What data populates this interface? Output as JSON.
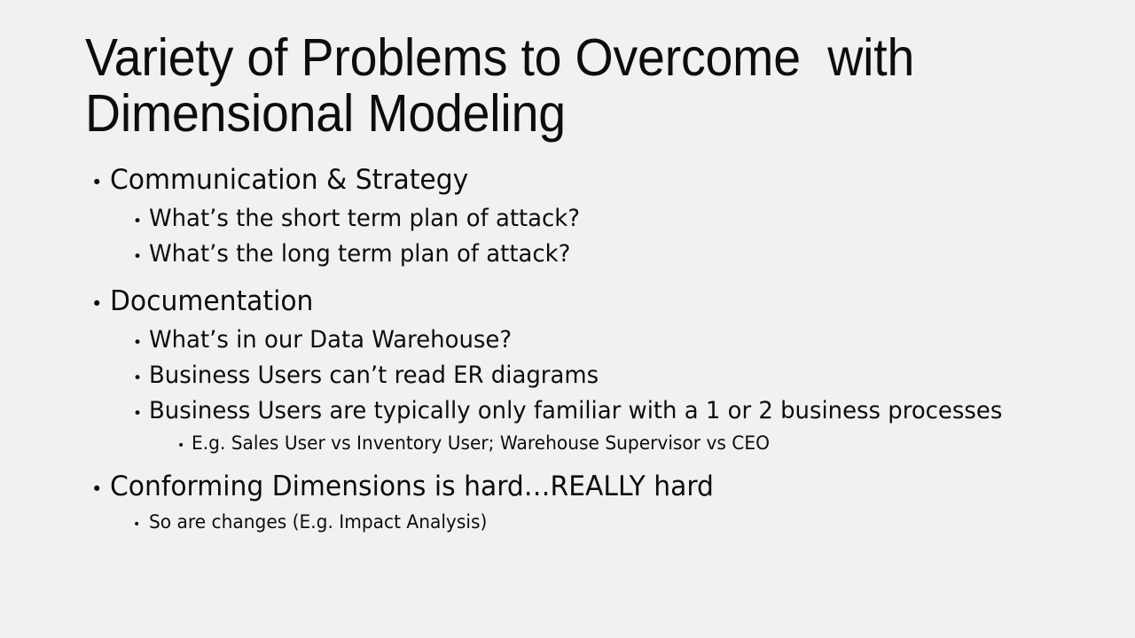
{
  "slide": {
    "background_color": "#f1f1f1",
    "text_color": "#0d0d0d",
    "title": "Variety of Problems to Overcome  with Dimensional Modeling",
    "bullet_glyph": "•",
    "content": [
      {
        "level": 1,
        "text": "Communication & Strategy"
      },
      {
        "level": 2,
        "text": "What’s the short term plan of attack?"
      },
      {
        "level": 2,
        "text": "What’s the long term plan of attack?"
      },
      {
        "level": 1,
        "text": "Documentation"
      },
      {
        "level": 2,
        "text": "What’s in our Data Warehouse?"
      },
      {
        "level": 2,
        "text": "Business Users can’t read ER diagrams"
      },
      {
        "level": 2,
        "text": "Business Users are typically only familiar with a 1 or 2 business processes"
      },
      {
        "level": 3,
        "text": "E.g. Sales User vs Inventory User; Warehouse Supervisor vs CEO"
      },
      {
        "level": 1,
        "text": "Conforming Dimensions is hard…REALLY hard"
      },
      {
        "level": 3,
        "indent_level": 2,
        "text": "So are changes (E.g. Impact Analysis)"
      }
    ]
  }
}
